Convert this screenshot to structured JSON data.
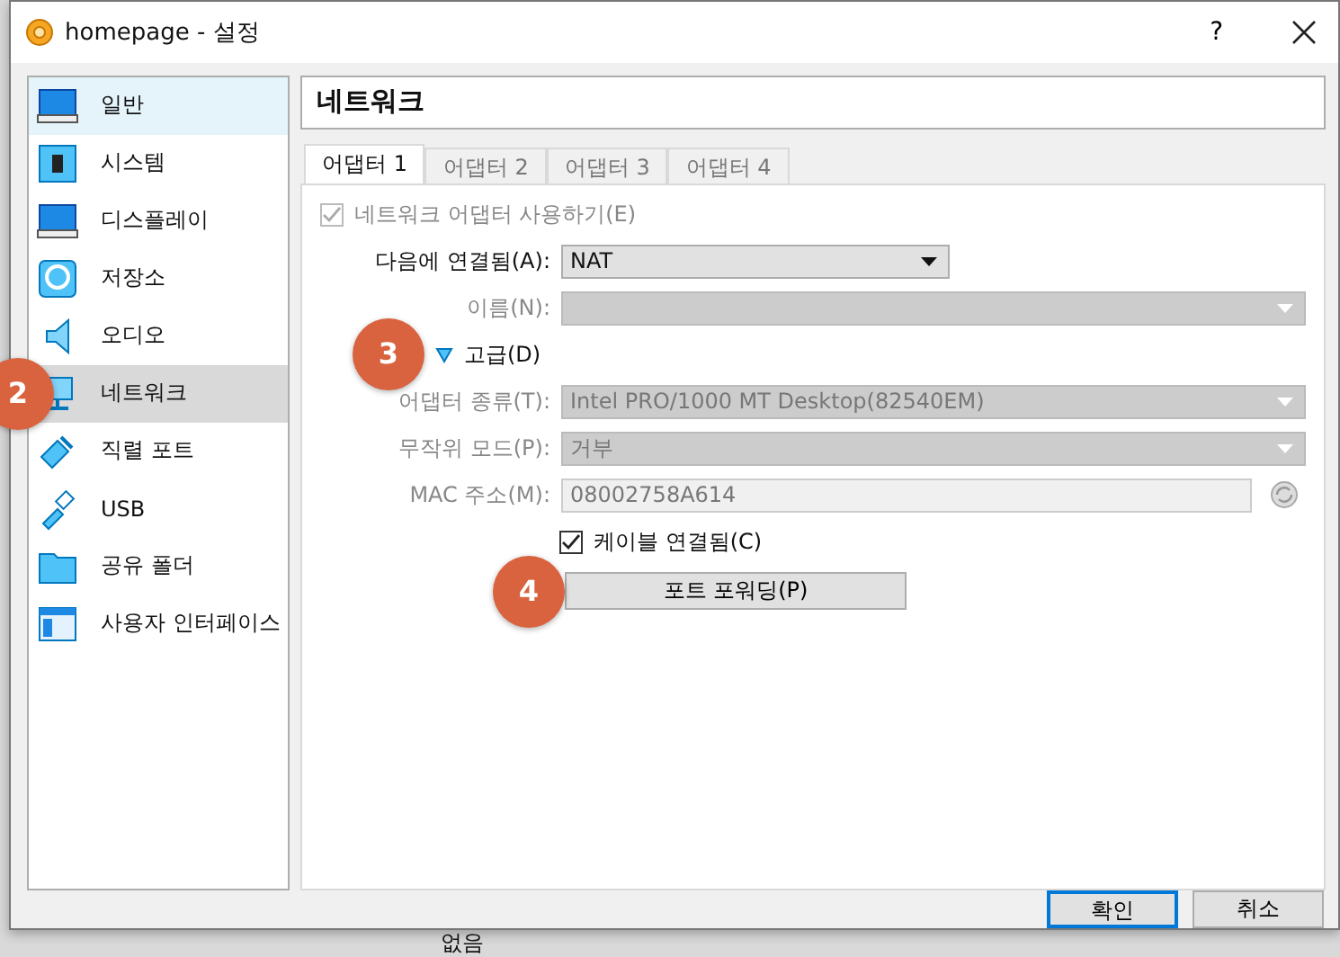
{
  "window": {
    "title": "homepage - 설정",
    "help": "?"
  },
  "sidebar": {
    "items": [
      {
        "label": "일반",
        "selected": false,
        "hovered": true
      },
      {
        "label": "시스템",
        "selected": false,
        "hovered": false
      },
      {
        "label": "디스플레이",
        "selected": false,
        "hovered": false
      },
      {
        "label": "저장소",
        "selected": false,
        "hovered": false
      },
      {
        "label": "오디오",
        "selected": false,
        "hovered": false
      },
      {
        "label": "네트워크",
        "selected": true,
        "hovered": false,
        "badge": "2"
      },
      {
        "label": "직렬 포트",
        "selected": false,
        "hovered": false
      },
      {
        "label": "USB",
        "selected": false,
        "hovered": false
      },
      {
        "label": "공유 폴더",
        "selected": false,
        "hovered": false
      },
      {
        "label": "사용자 인터페이스",
        "selected": false,
        "hovered": false
      }
    ]
  },
  "page_title": "네트워크",
  "tabs": [
    {
      "label": "어댑터 1",
      "selected": true
    },
    {
      "label": "어댑터 2",
      "selected": false
    },
    {
      "label": "어댑터 3",
      "selected": false
    },
    {
      "label": "어댑터 4",
      "selected": false
    }
  ],
  "rows": [
    {
      "kind": "checkbox",
      "label": "네트워크 어댑터 사용하기(E)",
      "checked": true,
      "disabled": true
    },
    {
      "kind": "select",
      "label": "다음에 연결됨(A):",
      "value": "NAT",
      "disabled": false
    },
    {
      "kind": "select",
      "label": "이름(N):",
      "disabled": true
    },
    {
      "kind": "disclosure",
      "label": "고급(D)",
      "expanded": true,
      "badge": "3"
    },
    {
      "kind": "select",
      "label": "어댑터 종류(T):",
      "value": "Intel PRO/1000 MT Desktop(82540EM)",
      "disabled": true
    },
    {
      "kind": "select",
      "label": "무작위 모드(P):",
      "value": "거부",
      "disabled": true
    },
    {
      "kind": "text",
      "label": "MAC 주소(M):",
      "value": "08002758A614",
      "disabled": true
    },
    {
      "kind": "checkbox",
      "label": "케이블 연결됨(C)",
      "checked": true,
      "disabled": false
    },
    {
      "kind": "button",
      "label": "포트 포워딩(P)",
      "badge": "4"
    }
  ],
  "buttons": [
    {
      "label": "확인",
      "default": true
    },
    {
      "label": "취소",
      "default": false
    }
  ],
  "background_text": "없음"
}
